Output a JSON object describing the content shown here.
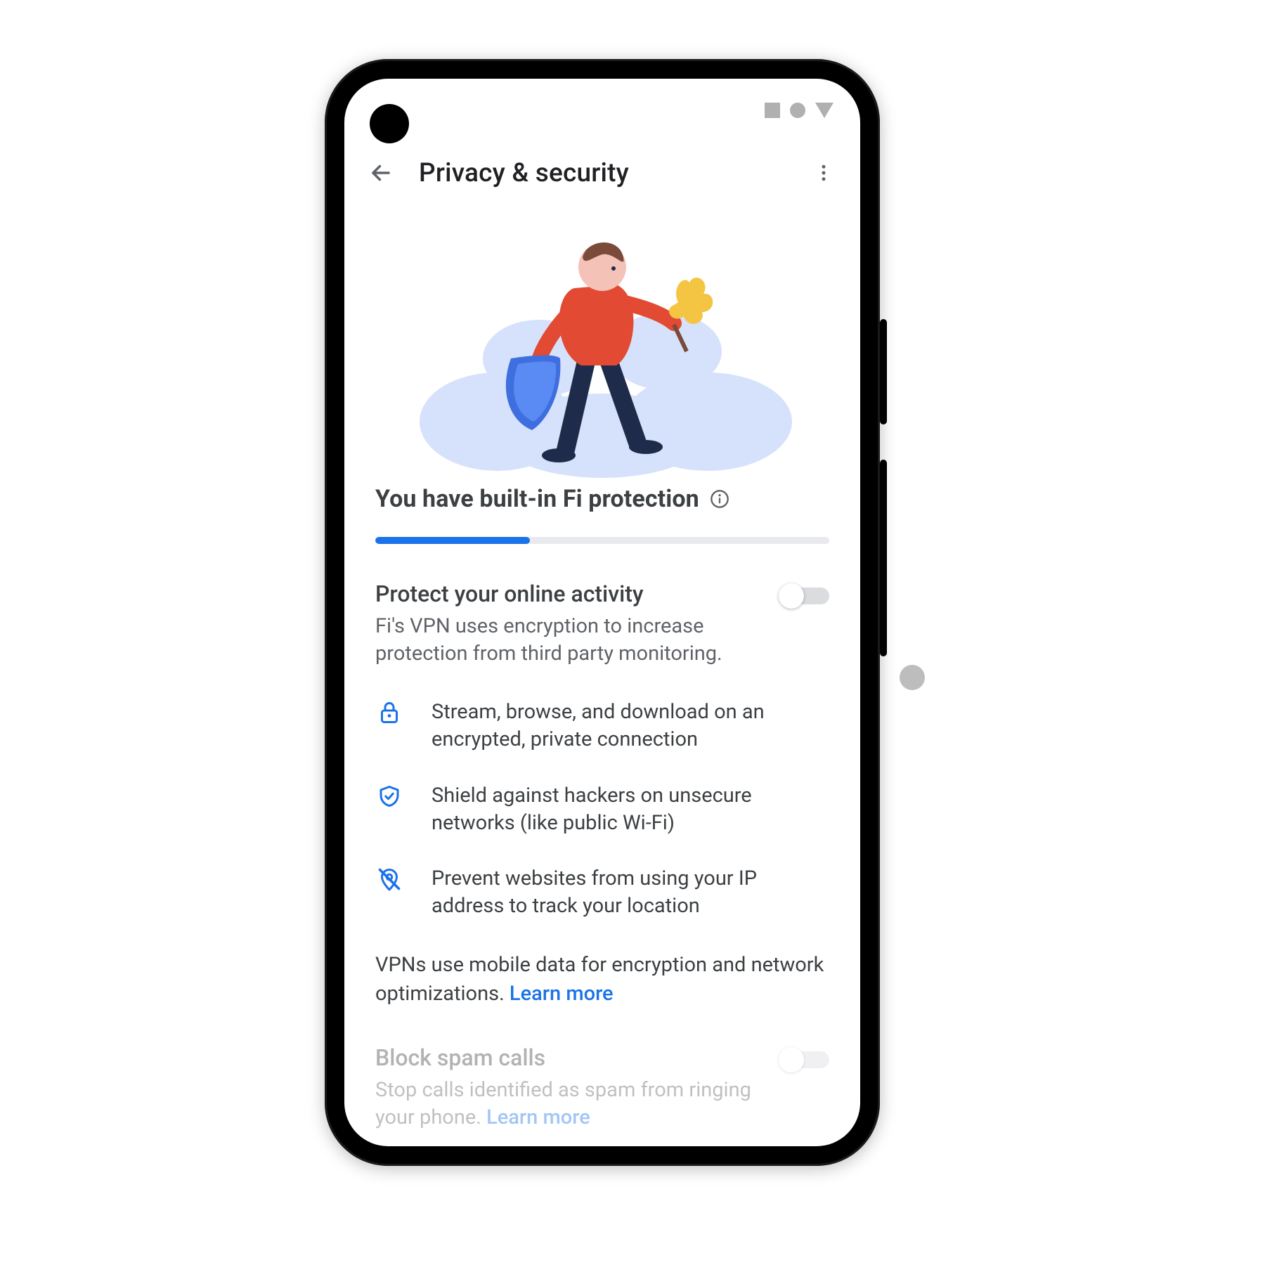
{
  "appbar": {
    "title": "Privacy & security"
  },
  "hero_headline": "You have built-in Fi protection",
  "progress_percent": 34,
  "vpn_setting": {
    "title": "Protect your online activity",
    "description": "Fi's VPN uses encryption to increase protection from third party monitoring.",
    "enabled": false
  },
  "features": [
    {
      "icon": "lock-icon",
      "text": "Stream, browse, and download on an encrypted, private connection"
    },
    {
      "icon": "shield-check-icon",
      "text": "Shield against hackers on unsecure networks (like public Wi-Fi)"
    },
    {
      "icon": "location-off-icon",
      "text": "Prevent websites from using your IP address to track your location"
    }
  ],
  "vpn_note": {
    "text": "VPNs use mobile data for encryption and network optimizations. ",
    "link": "Learn more"
  },
  "spam_setting": {
    "title": "Block spam calls",
    "description_text": "Stop calls identified as spam from ringing your phone. ",
    "description_link": "Learn more",
    "enabled": false
  },
  "colors": {
    "accent": "#1a73e8",
    "text_primary": "#3c4043",
    "text_secondary": "#5f6368"
  }
}
